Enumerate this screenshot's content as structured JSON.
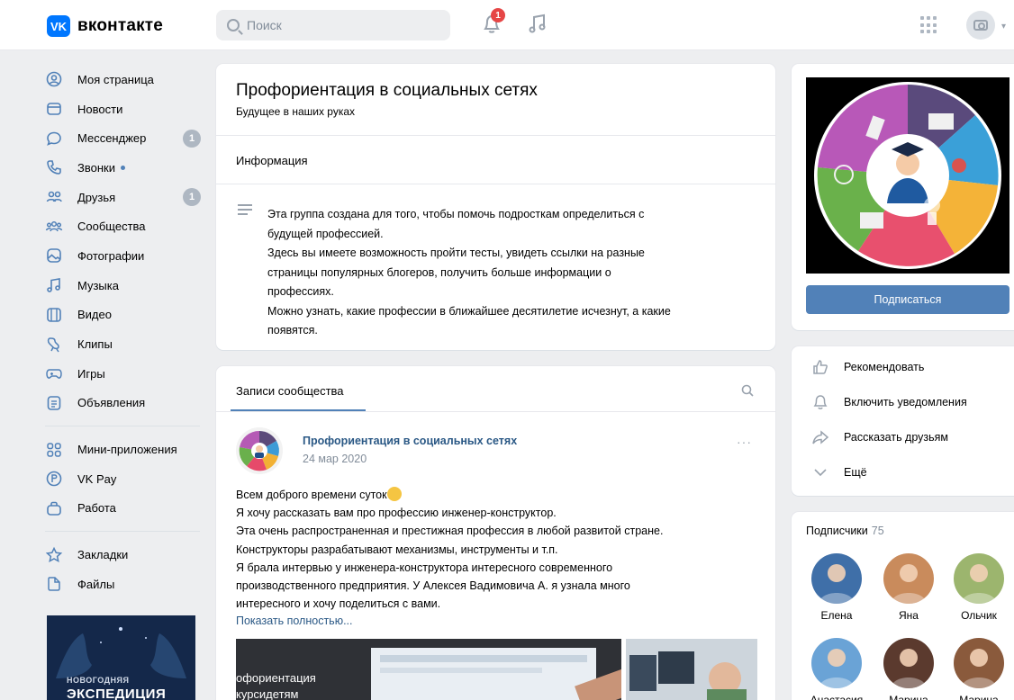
{
  "header": {
    "logo_letter": "VK",
    "logo_text": "вконтакте",
    "search_placeholder": "Поиск",
    "notifications_count": "1"
  },
  "nav": {
    "items": [
      {
        "label": "Моя страница",
        "icon": "user-circle-icon"
      },
      {
        "label": "Новости",
        "icon": "newspaper-icon"
      },
      {
        "label": "Мессенджер",
        "icon": "chat-icon",
        "badge": "1"
      },
      {
        "label": "Звонки",
        "icon": "phone-icon"
      },
      {
        "label": "Друзья",
        "icon": "friends-icon",
        "badge": "1"
      },
      {
        "label": "Сообщества",
        "icon": "communities-icon"
      },
      {
        "label": "Фотографии",
        "icon": "photos-icon"
      },
      {
        "label": "Музыка",
        "icon": "music-icon"
      },
      {
        "label": "Видео",
        "icon": "video-icon"
      },
      {
        "label": "Клипы",
        "icon": "clips-icon"
      },
      {
        "label": "Игры",
        "icon": "gamepad-icon"
      },
      {
        "label": "Объявления",
        "icon": "ads-icon"
      }
    ],
    "items2": [
      {
        "label": "Мини-приложения",
        "icon": "apps-icon"
      },
      {
        "label": "VK Pay",
        "icon": "vkpay-icon"
      },
      {
        "label": "Работа",
        "icon": "briefcase-icon"
      }
    ],
    "items3": [
      {
        "label": "Закладки",
        "icon": "star-icon"
      },
      {
        "label": "Файлы",
        "icon": "file-icon"
      }
    ],
    "promo_line1": "НОВОГОДНЯЯ",
    "promo_line2": "ЭКСПЕДИЦИЯ"
  },
  "group": {
    "title": "Профориентация в социальных сетях",
    "status": "Будущее в наших руках",
    "info_heading": "Информация",
    "description": [
      "Эта группа создана для того, чтобы помочь подросткам определиться с",
      "будущей профессией.",
      "Здесь вы имеете возможность пройти тесты, увидеть ссылки на разные",
      "страницы популярных блогеров, получить больше информации о",
      "профессиях.",
      "Можно узнать, какие профессии в ближайшее десятилетие исчезнут, а какие",
      "появятся."
    ]
  },
  "wall": {
    "tab_label": "Записи сообщества",
    "post": {
      "author": "Профориентация в социальных сетях",
      "date": "24 мар 2020",
      "more": "···",
      "lines": [
        "Всем доброго времени суток",
        "Я хочу рассказать вам про профессию инженер-конструктор.",
        "Эта очень распространенная и престижная профессия в любой развитой стране.",
        "Конструкторы разрабатывают механизмы, инструменты и т.п.",
        "Я брала интервью у инженера-конструктора интересного современного",
        "производственного предприятия. У Алексея Вадимовича А. я узнала много",
        "интересного и хочу поделиться с вами."
      ],
      "show_more": "Показать полностью...",
      "image_caption_1": "офориентация",
      "image_caption_2": "курсидетям"
    }
  },
  "sidebar": {
    "subscribe_label": "Подписаться",
    "actions": [
      {
        "label": "Рекомендовать",
        "icon": "thumbs-up-icon"
      },
      {
        "label": "Включить уведомления",
        "icon": "bell-icon"
      },
      {
        "label": "Рассказать друзьям",
        "icon": "share-icon"
      },
      {
        "label": "Ещё",
        "icon": "chevron-down-icon"
      }
    ],
    "subscribers_title": "Подписчики",
    "subscribers_count": "75",
    "subscribers": [
      {
        "name": "Елена",
        "color": "#3f6fa8"
      },
      {
        "name": "Яна",
        "color": "#c98b5c"
      },
      {
        "name": "Ольчик",
        "color": "#9cb56e"
      },
      {
        "name": "Анастасия",
        "color": "#6aa3d6"
      },
      {
        "name": "Марина",
        "color": "#5b3a2e"
      },
      {
        "name": "Марина",
        "color": "#8a5a3c"
      }
    ]
  },
  "colors": {
    "accent": "#5181b8",
    "link": "#2a5885",
    "badge": "#e64646"
  }
}
